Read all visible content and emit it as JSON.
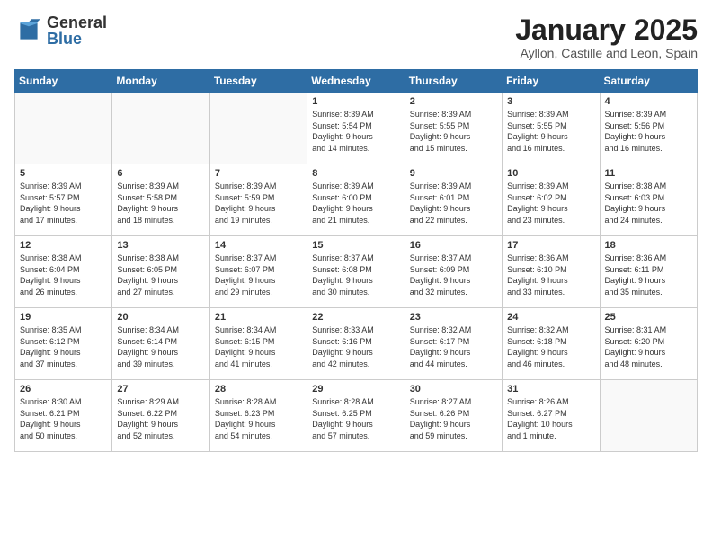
{
  "header": {
    "logo_general": "General",
    "logo_blue": "Blue",
    "month": "January 2025",
    "location": "Ayllon, Castille and Leon, Spain"
  },
  "days_of_week": [
    "Sunday",
    "Monday",
    "Tuesday",
    "Wednesday",
    "Thursday",
    "Friday",
    "Saturday"
  ],
  "weeks": [
    [
      {
        "day": "",
        "info": ""
      },
      {
        "day": "",
        "info": ""
      },
      {
        "day": "",
        "info": ""
      },
      {
        "day": "1",
        "info": "Sunrise: 8:39 AM\nSunset: 5:54 PM\nDaylight: 9 hours\nand 14 minutes."
      },
      {
        "day": "2",
        "info": "Sunrise: 8:39 AM\nSunset: 5:55 PM\nDaylight: 9 hours\nand 15 minutes."
      },
      {
        "day": "3",
        "info": "Sunrise: 8:39 AM\nSunset: 5:55 PM\nDaylight: 9 hours\nand 16 minutes."
      },
      {
        "day": "4",
        "info": "Sunrise: 8:39 AM\nSunset: 5:56 PM\nDaylight: 9 hours\nand 16 minutes."
      }
    ],
    [
      {
        "day": "5",
        "info": "Sunrise: 8:39 AM\nSunset: 5:57 PM\nDaylight: 9 hours\nand 17 minutes."
      },
      {
        "day": "6",
        "info": "Sunrise: 8:39 AM\nSunset: 5:58 PM\nDaylight: 9 hours\nand 18 minutes."
      },
      {
        "day": "7",
        "info": "Sunrise: 8:39 AM\nSunset: 5:59 PM\nDaylight: 9 hours\nand 19 minutes."
      },
      {
        "day": "8",
        "info": "Sunrise: 8:39 AM\nSunset: 6:00 PM\nDaylight: 9 hours\nand 21 minutes."
      },
      {
        "day": "9",
        "info": "Sunrise: 8:39 AM\nSunset: 6:01 PM\nDaylight: 9 hours\nand 22 minutes."
      },
      {
        "day": "10",
        "info": "Sunrise: 8:39 AM\nSunset: 6:02 PM\nDaylight: 9 hours\nand 23 minutes."
      },
      {
        "day": "11",
        "info": "Sunrise: 8:38 AM\nSunset: 6:03 PM\nDaylight: 9 hours\nand 24 minutes."
      }
    ],
    [
      {
        "day": "12",
        "info": "Sunrise: 8:38 AM\nSunset: 6:04 PM\nDaylight: 9 hours\nand 26 minutes."
      },
      {
        "day": "13",
        "info": "Sunrise: 8:38 AM\nSunset: 6:05 PM\nDaylight: 9 hours\nand 27 minutes."
      },
      {
        "day": "14",
        "info": "Sunrise: 8:37 AM\nSunset: 6:07 PM\nDaylight: 9 hours\nand 29 minutes."
      },
      {
        "day": "15",
        "info": "Sunrise: 8:37 AM\nSunset: 6:08 PM\nDaylight: 9 hours\nand 30 minutes."
      },
      {
        "day": "16",
        "info": "Sunrise: 8:37 AM\nSunset: 6:09 PM\nDaylight: 9 hours\nand 32 minutes."
      },
      {
        "day": "17",
        "info": "Sunrise: 8:36 AM\nSunset: 6:10 PM\nDaylight: 9 hours\nand 33 minutes."
      },
      {
        "day": "18",
        "info": "Sunrise: 8:36 AM\nSunset: 6:11 PM\nDaylight: 9 hours\nand 35 minutes."
      }
    ],
    [
      {
        "day": "19",
        "info": "Sunrise: 8:35 AM\nSunset: 6:12 PM\nDaylight: 9 hours\nand 37 minutes."
      },
      {
        "day": "20",
        "info": "Sunrise: 8:34 AM\nSunset: 6:14 PM\nDaylight: 9 hours\nand 39 minutes."
      },
      {
        "day": "21",
        "info": "Sunrise: 8:34 AM\nSunset: 6:15 PM\nDaylight: 9 hours\nand 41 minutes."
      },
      {
        "day": "22",
        "info": "Sunrise: 8:33 AM\nSunset: 6:16 PM\nDaylight: 9 hours\nand 42 minutes."
      },
      {
        "day": "23",
        "info": "Sunrise: 8:32 AM\nSunset: 6:17 PM\nDaylight: 9 hours\nand 44 minutes."
      },
      {
        "day": "24",
        "info": "Sunrise: 8:32 AM\nSunset: 6:18 PM\nDaylight: 9 hours\nand 46 minutes."
      },
      {
        "day": "25",
        "info": "Sunrise: 8:31 AM\nSunset: 6:20 PM\nDaylight: 9 hours\nand 48 minutes."
      }
    ],
    [
      {
        "day": "26",
        "info": "Sunrise: 8:30 AM\nSunset: 6:21 PM\nDaylight: 9 hours\nand 50 minutes."
      },
      {
        "day": "27",
        "info": "Sunrise: 8:29 AM\nSunset: 6:22 PM\nDaylight: 9 hours\nand 52 minutes."
      },
      {
        "day": "28",
        "info": "Sunrise: 8:28 AM\nSunset: 6:23 PM\nDaylight: 9 hours\nand 54 minutes."
      },
      {
        "day": "29",
        "info": "Sunrise: 8:28 AM\nSunset: 6:25 PM\nDaylight: 9 hours\nand 57 minutes."
      },
      {
        "day": "30",
        "info": "Sunrise: 8:27 AM\nSunset: 6:26 PM\nDaylight: 9 hours\nand 59 minutes."
      },
      {
        "day": "31",
        "info": "Sunrise: 8:26 AM\nSunset: 6:27 PM\nDaylight: 10 hours\nand 1 minute."
      },
      {
        "day": "",
        "info": ""
      }
    ]
  ]
}
